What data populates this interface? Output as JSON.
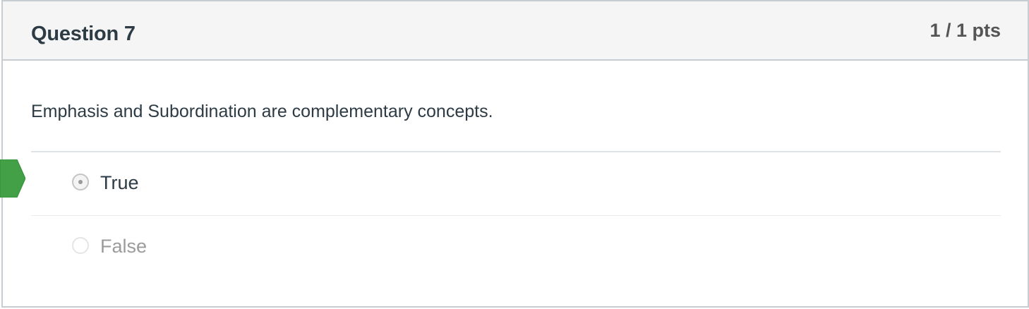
{
  "question": {
    "name": "Question 7",
    "points": "1 / 1 pts",
    "text": "Emphasis and Subordination are complementary concepts."
  },
  "answers": [
    {
      "label": "True",
      "selected": true,
      "correct": true
    },
    {
      "label": "False",
      "selected": false,
      "correct": false
    }
  ],
  "colors": {
    "correct_marker": "#43a047",
    "header_background": "#f5f5f5",
    "border": "#c7cdd1",
    "text": "#2d3b45",
    "muted_text": "#9b9b9b"
  }
}
